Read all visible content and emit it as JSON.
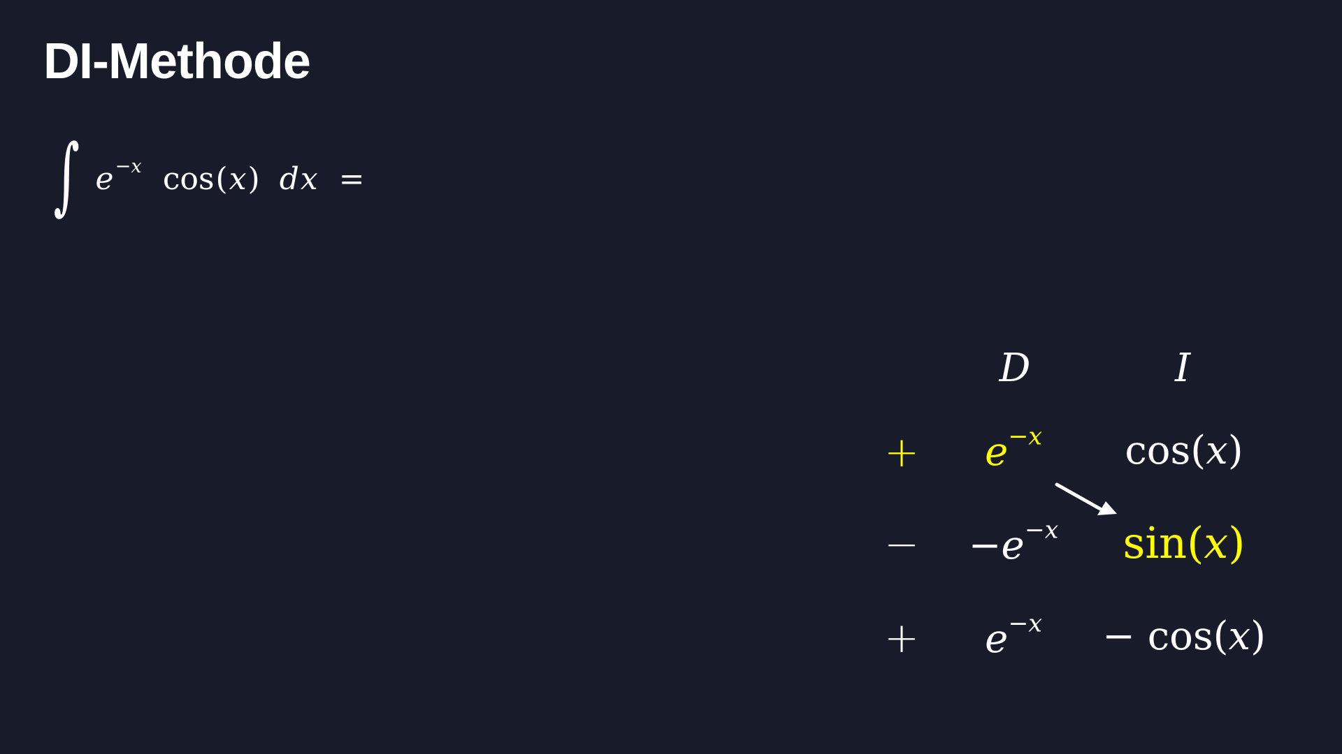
{
  "title": "DI-Methode",
  "integral": {
    "sign": "∫",
    "base": "e",
    "exponent": "−x",
    "func": "cos",
    "arg_open": "(",
    "arg": "x",
    "arg_close": ")",
    "d": "d",
    "var": "x",
    "equals": "="
  },
  "table": {
    "header_d": "D",
    "header_i": "I",
    "rows": [
      {
        "sign": "+",
        "d_prefix": "",
        "d_base": "e",
        "d_exp": "−x",
        "i_prefix": "",
        "i_func": "cos",
        "i_open": "(",
        "i_arg": "x",
        "i_close": ")"
      },
      {
        "sign": "−",
        "d_prefix": "−",
        "d_base": "e",
        "d_exp": "−x",
        "i_prefix": "",
        "i_func": "sin",
        "i_open": "(",
        "i_arg": "x",
        "i_close": ")"
      },
      {
        "sign": "+",
        "d_prefix": "",
        "d_base": "e",
        "d_exp": "−x",
        "i_prefix": "− ",
        "i_func": "cos",
        "i_open": "(",
        "i_arg": "x",
        "i_close": ")"
      }
    ]
  },
  "colors": {
    "background": "#181c2a",
    "text": "#ffffff",
    "highlight": "#ffff00"
  }
}
